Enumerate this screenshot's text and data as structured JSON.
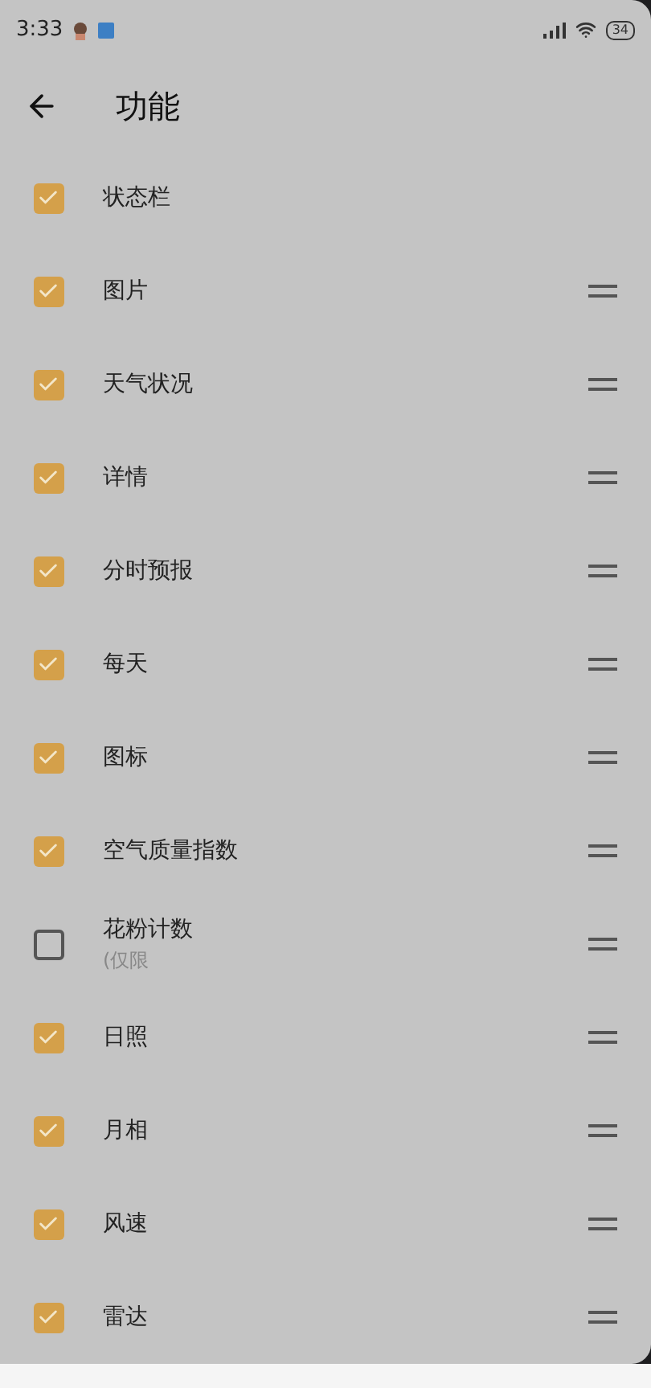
{
  "status_bar": {
    "time": "3:33",
    "battery": "34"
  },
  "header": {
    "title": "功能"
  },
  "items": [
    {
      "label": "状态栏",
      "checked": true,
      "draggable": false
    },
    {
      "label": "图片",
      "checked": true,
      "draggable": true
    },
    {
      "label": "天气状况",
      "checked": true,
      "draggable": true
    },
    {
      "label": "详情",
      "checked": true,
      "draggable": true
    },
    {
      "label": "分时预报",
      "checked": true,
      "draggable": true
    },
    {
      "label": "每天",
      "checked": true,
      "draggable": true
    },
    {
      "label": "图标",
      "checked": true,
      "draggable": true
    },
    {
      "label": "空气质量指数",
      "checked": true,
      "draggable": true
    },
    {
      "label": "花粉计数",
      "sublabel": "(仅限",
      "checked": false,
      "draggable": true
    },
    {
      "label": "日照",
      "checked": true,
      "draggable": true
    },
    {
      "label": "月相",
      "checked": true,
      "draggable": true
    },
    {
      "label": "风速",
      "checked": true,
      "draggable": true
    },
    {
      "label": "雷达",
      "checked": true,
      "draggable": true
    }
  ]
}
